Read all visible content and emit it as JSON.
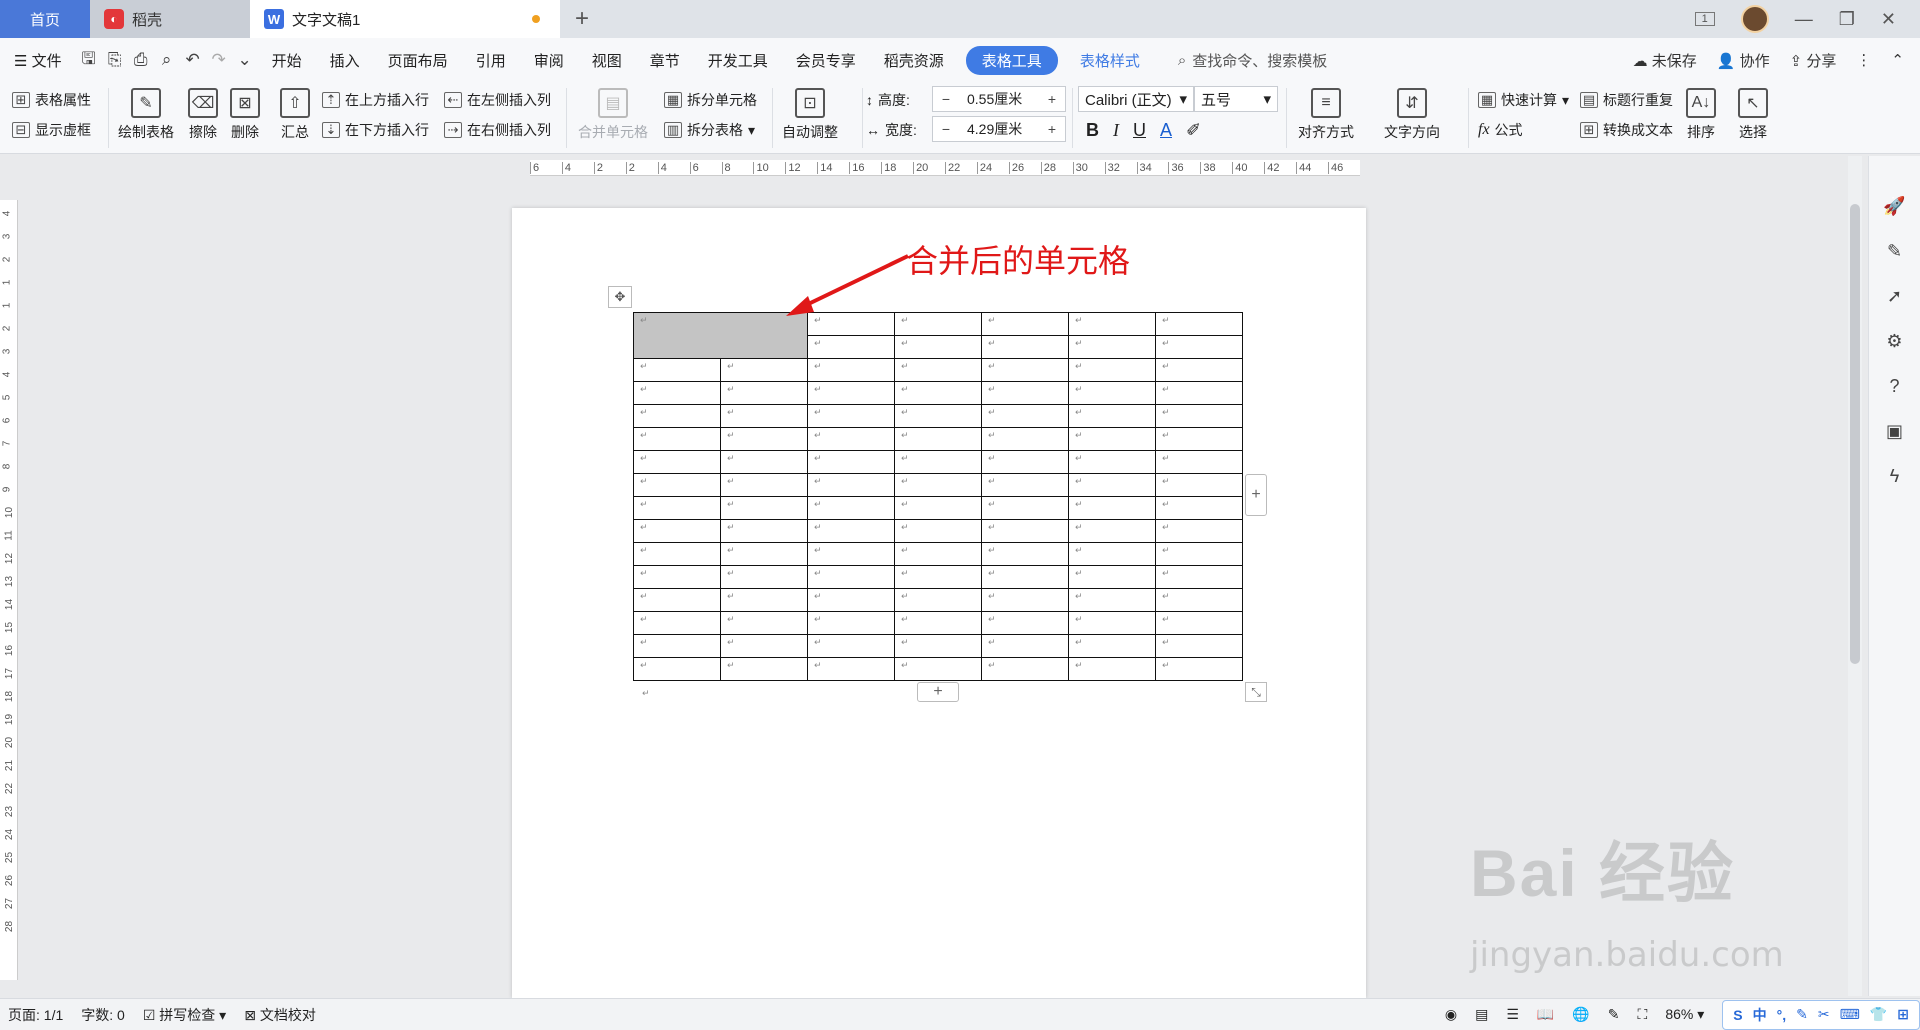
{
  "titlebar": {
    "tabs": [
      {
        "label": "首页"
      },
      {
        "label": "稻壳",
        "icon": "daoke-logo-icon"
      },
      {
        "label": "文字文稿1",
        "icon": "wps-writer-icon"
      }
    ],
    "add_tab": "+",
    "badge": "1"
  },
  "menubar": {
    "file": "文件",
    "items": [
      "开始",
      "插入",
      "页面布局",
      "引用",
      "审阅",
      "视图",
      "章节",
      "开发工具",
      "会员专享",
      "稻壳资源"
    ],
    "active": "表格工具",
    "secondary": "表格样式",
    "search_placeholder": "查找命令、搜索模板",
    "right": [
      "未保存",
      "协作",
      "分享"
    ]
  },
  "ribbon": {
    "table_props": "表格属性",
    "show_gridlines": "显示虚框",
    "draw_table": "绘制表格",
    "eraser": "擦除",
    "delete": "删除",
    "summary": "汇总",
    "insert_above": "在上方插入行",
    "insert_below": "在下方插入行",
    "insert_left": "在左侧插入列",
    "insert_right": "在右侧插入列",
    "merge_cells": "合并单元格",
    "split_cells": "拆分单元格",
    "split_table": "拆分表格",
    "autofit": "自动调整",
    "height_label": "高度:",
    "height_value": "0.55厘米",
    "width_label": "宽度:",
    "width_value": "4.29厘米",
    "font_name": "Calibri (正文)",
    "font_size": "五号",
    "align": "对齐方式",
    "text_dir": "文字方向",
    "quick_calc": "快速计算",
    "formula": "公式",
    "repeat_header": "标题行重复",
    "to_text": "转换成文本",
    "sort": "排序",
    "select": "选择"
  },
  "ruler": {
    "h_ticks": [
      "6",
      "4",
      "2",
      "2",
      "4",
      "6",
      "8",
      "10",
      "12",
      "14",
      "16",
      "18",
      "20",
      "22",
      "24",
      "26",
      "28",
      "30",
      "32",
      "34",
      "36",
      "38",
      "40",
      "42",
      "44",
      "46"
    ],
    "v_ticks": [
      "4",
      "3",
      "2",
      "1",
      "1",
      "2",
      "3",
      "4",
      "5",
      "6",
      "7",
      "8",
      "9",
      "10",
      "11",
      "12",
      "13",
      "14",
      "15",
      "16",
      "17",
      "18",
      "19",
      "20",
      "21",
      "22",
      "23",
      "24",
      "25",
      "26",
      "27",
      "28"
    ]
  },
  "document": {
    "annotation": "合并后的单元格",
    "para_mark": "↵",
    "rows": 16,
    "cols": 7
  },
  "statusbar": {
    "page": "页面: 1/1",
    "words": "字数: 0",
    "spellcheck": "拼写检查",
    "doc_check": "文档校对",
    "zoom": "86%",
    "ime": "中"
  },
  "watermark": {
    "brand": "Bai 经验",
    "url": "jingyan.baidu.com"
  },
  "colors": {
    "accent": "#3f7be4",
    "annotation": "#e01818",
    "merged_cell": "#c4c4c4"
  }
}
